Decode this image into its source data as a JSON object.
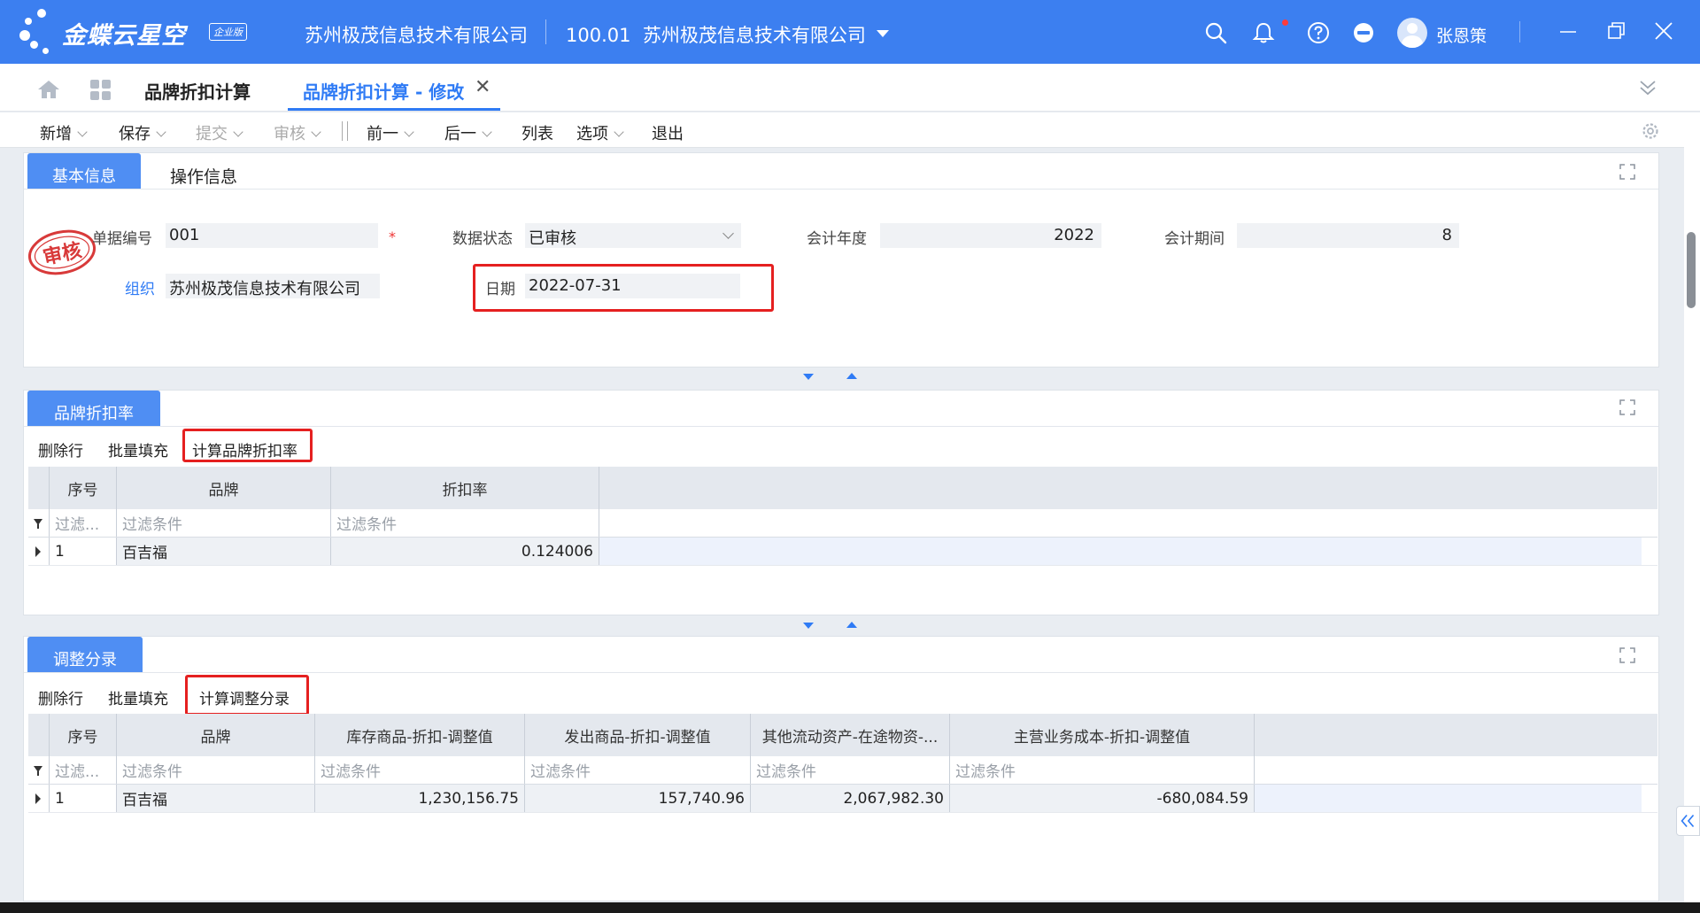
{
  "titlebar": {
    "brand": "金蝶云星空",
    "edition_badge": "企业版",
    "company": "苏州极茂信息技术有限公司",
    "org_code": "100.01",
    "org_name": "苏州极茂信息技术有限公司",
    "username": "张恩策",
    "icons": [
      "search-icon",
      "bell-icon",
      "help-icon",
      "minus-circle-icon",
      "avatar",
      "minimize-icon",
      "restore-icon",
      "close-icon"
    ]
  },
  "tabs": [
    {
      "label": "品牌折扣计算",
      "active": false
    },
    {
      "label": "品牌折扣计算 - 修改",
      "active": true
    }
  ],
  "toolbar": {
    "new": "新增",
    "save": "保存",
    "submit": "提交",
    "audit": "审核",
    "prev": "前一",
    "next": "后一",
    "list": "列表",
    "options": "选项",
    "exit": "退出"
  },
  "basic_panel": {
    "tab_active": "基本信息",
    "tab_inactive": "操作信息",
    "stamp_text": "审核",
    "fields": {
      "bill_no_label": "单据编号",
      "bill_no": "001",
      "required_mark": "*",
      "status_label": "数据状态",
      "status": "已审核",
      "year_label": "会计年度",
      "year": "2022",
      "period_label": "会计期间",
      "period": "8",
      "org_label": "组织",
      "org": "苏州极茂信息技术有限公司",
      "date_label": "日期",
      "date": "2022-07-31"
    }
  },
  "discount_panel": {
    "tab": "品牌折扣率",
    "actions": {
      "delete_row": "删除行",
      "batch_fill": "批量填充",
      "calc": "计算品牌折扣率"
    },
    "columns": [
      "序号",
      "品牌",
      "折扣率"
    ],
    "filters": [
      "过滤...",
      "过滤条件",
      "过滤条件"
    ],
    "rows": [
      {
        "seq": "1",
        "brand": "百吉福",
        "rate": "0.124006"
      }
    ]
  },
  "adjust_panel": {
    "tab": "调整分录",
    "actions": {
      "delete_row": "删除行",
      "batch_fill": "批量填充",
      "calc": "计算调整分录"
    },
    "columns": [
      "序号",
      "品牌",
      "库存商品-折扣-调整值",
      "发出商品-折扣-调整值",
      "其他流动资产-在途物资-...",
      "主营业务成本-折扣-调整值"
    ],
    "filters": [
      "过滤...",
      "过滤条件",
      "过滤条件",
      "过滤条件",
      "过滤条件",
      "过滤条件"
    ],
    "rows": [
      {
        "seq": "1",
        "brand": "百吉福",
        "inventory": "1,230,156.75",
        "shipped": "157,740.96",
        "in_transit": "2,067,982.30",
        "cost": "-680,084.59"
      }
    ]
  },
  "colors": {
    "titlebar": "#3c7ff0",
    "accent": "#2f7bf5",
    "panel_tab": "#4f8ef3",
    "highlight_box": "#e52020"
  }
}
